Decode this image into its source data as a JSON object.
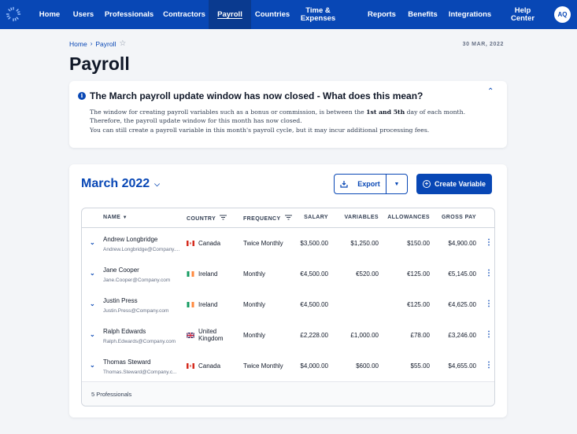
{
  "nav": {
    "items": [
      "Home",
      "Users",
      "Professionals",
      "Contractors",
      "Payroll",
      "Countries",
      "Time & Expenses",
      "Reports",
      "Benefits",
      "Integrations",
      "Help Center"
    ],
    "active": "Payroll",
    "avatar": "AQ",
    "brand_color": "#0847b5"
  },
  "breadcrumb": {
    "home": "Home",
    "current": "Payroll",
    "separator": "›",
    "star": "☆"
  },
  "date": "30 MAR, 2022",
  "page_title": "Payroll",
  "notice": {
    "icon": "info-icon",
    "title": "The March payroll update window has now closed - What does this mean?",
    "line1_before": "The window for creating payroll variables such as a bonus or commission, is between the ",
    "line1_bold": "1st and 5th",
    "line1_after": " day of each month.",
    "line2": "Therefore, the payroll update window for this month has now closed.",
    "line3": "You can still create a payroll variable in this month's payroll cycle, but it may incur additional processing fees."
  },
  "period": "March 2022",
  "actions": {
    "export": "Export",
    "create": "Create Variable"
  },
  "table": {
    "headers": {
      "name": "NAME",
      "country": "COUNTRY",
      "frequency": "FREQUENCY",
      "salary": "SALARY",
      "variables": "VARIABLES",
      "allowances": "ALLOWANCES",
      "gross": "GROSS PAY"
    },
    "rows": [
      {
        "name": "Andrew Longbridge",
        "email": "Andrew.Longbridge@Company....",
        "country": "Canada",
        "flag": "canada",
        "frequency": "Twice Monthly",
        "salary": "$3,500.00",
        "variables": "$1,250.00",
        "allowances": "$150.00",
        "gross": "$4,900.00"
      },
      {
        "name": "Jane Cooper",
        "email": "Jane.Cooper@Company.com",
        "country": "Ireland",
        "flag": "ireland",
        "frequency": "Monthly",
        "salary": "€4,500.00",
        "variables": "€520.00",
        "allowances": "€125.00",
        "gross": "€5,145.00"
      },
      {
        "name": "Justin Press",
        "email": "Justin.Press@Company.com",
        "country": "Ireland",
        "flag": "ireland",
        "frequency": "Monthly",
        "salary": "€4,500.00",
        "variables": "",
        "allowances": "€125.00",
        "gross": "€4,625.00"
      },
      {
        "name": "Ralph Edwards",
        "email": "Ralph.Edwards@Company.com",
        "country": "United Kingdom",
        "country_line1": "United",
        "country_line2": "Kingdom",
        "flag": "uk",
        "frequency": "Monthly",
        "salary": "£2,228.00",
        "variables": "£1,000.00",
        "allowances": "£78.00",
        "gross": "£3,246.00"
      },
      {
        "name": "Thomas Steward",
        "email": "Thomas.Steward@Company.c...",
        "country": "Canada",
        "flag": "canada",
        "frequency": "Twice Monthly",
        "salary": "$4,000.00",
        "variables": "$600.00",
        "allowances": "$55.00",
        "gross": "$4,655.00"
      }
    ],
    "footer": "5 Professionals"
  }
}
